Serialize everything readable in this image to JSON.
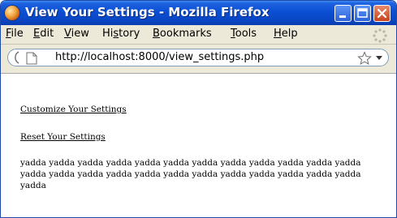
{
  "window": {
    "title": "View Your Settings - Mozilla Firefox"
  },
  "menubar": {
    "items": [
      {
        "label": "File",
        "accel_index": 0
      },
      {
        "label": "Edit",
        "accel_index": 0
      },
      {
        "label": "View",
        "accel_index": 0
      },
      {
        "label": "History",
        "accel_index": 2
      },
      {
        "label": "Bookmarks",
        "accel_index": 0
      },
      {
        "label": "Tools",
        "accel_index": 0
      },
      {
        "label": "Help",
        "accel_index": 0
      }
    ]
  },
  "navbar": {
    "url": "http://localhost:8000/view_settings.php"
  },
  "page": {
    "links": [
      {
        "label": "Customize Your Settings"
      },
      {
        "label": "Reset Your Settings"
      }
    ],
    "body": "yadda yadda yadda yadda yadda yadda yadda yadda yadda yadda yadda yadda yadda yadda yadda yadda yadda yadda yadda yadda yadda yadda yadda yadda yadda"
  },
  "colors": {
    "titlebar": "#0a4fd4",
    "chrome": "#ece9d8",
    "close_button": "#c9431e"
  },
  "icons": [
    "app-icon",
    "minimize-icon",
    "maximize-icon",
    "close-icon",
    "throbber-icon",
    "back-icon",
    "page-icon",
    "bookmark-star-icon",
    "dropdown-arrow-icon"
  ]
}
